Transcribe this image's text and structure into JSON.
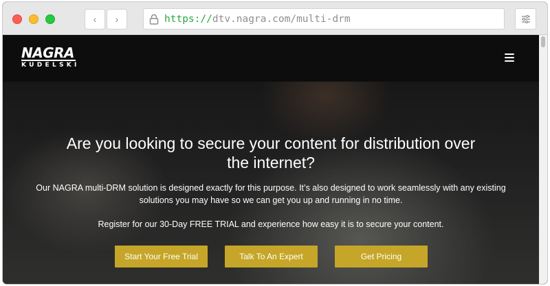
{
  "browser": {
    "url_scheme": "https",
    "url_separator": "://",
    "url_rest": "dtv.nagra.com/multi-drm",
    "back_glyph": "‹",
    "forward_glyph": "›",
    "icons": [
      "lock-icon",
      "settings-sliders-icon",
      "back-arrow-icon",
      "forward-arrow-icon"
    ]
  },
  "header": {
    "logo_main": "NAGRA",
    "logo_sub": "KUDELSKI",
    "menu_icon": "hamburger-icon"
  },
  "hero": {
    "headline": "Are you looking to secure your content for distribution over the internet?",
    "description": "Our NAGRA multi-DRM solution is designed exactly for this purpose. It’s also designed to work seamlessly with any existing solutions you may have so we can get you up and running in no time.",
    "register_text": "Register for our 30-Day FREE TRIAL and experience how easy it is to secure your content.",
    "buttons": {
      "trial": "Start Your Free Trial",
      "expert": "Talk To An Expert",
      "pricing": "Get Pricing"
    }
  },
  "colors": {
    "accent": "#c6a628",
    "header_bg": "#0d0d0d",
    "url_scheme": "#28a745"
  }
}
